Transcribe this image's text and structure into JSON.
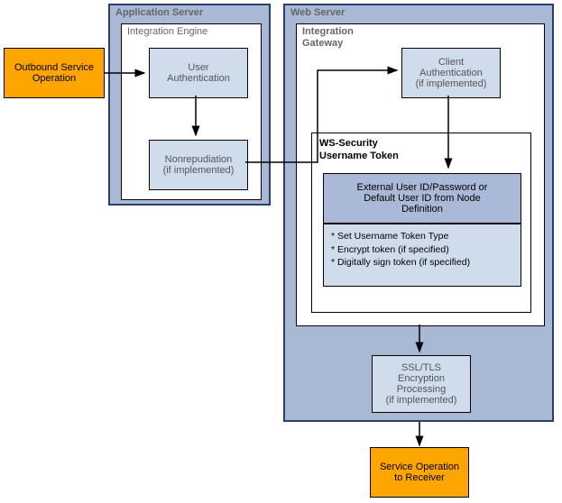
{
  "outbound": {
    "label": "Outbound Service\nOperation"
  },
  "app_server": {
    "title": "Application Server",
    "engine_title": "Integration Engine",
    "user_auth": "User\nAuthentication",
    "nonrepudiation": "Nonrepudiation\n(if implemented)"
  },
  "web_server": {
    "title": "Web Server",
    "gateway_title": "Integration\nGateway",
    "client_auth": "Client\nAuthentication\n(if implemented)",
    "ws_security": {
      "title": "WS-Security\nUsername Token",
      "ext_user": "External User ID/Password or\nDefault User ID from Node\nDefinition",
      "bullets": [
        "* Set Username Token Type",
        "* Encrypt token (if specified)",
        "* Digitally sign token (if specified)"
      ]
    },
    "ssl": "SSL/TLS\nEncryption\nProcessing\n(if implemented)"
  },
  "service_op": {
    "label": "Service Operation\nto Receiver"
  }
}
